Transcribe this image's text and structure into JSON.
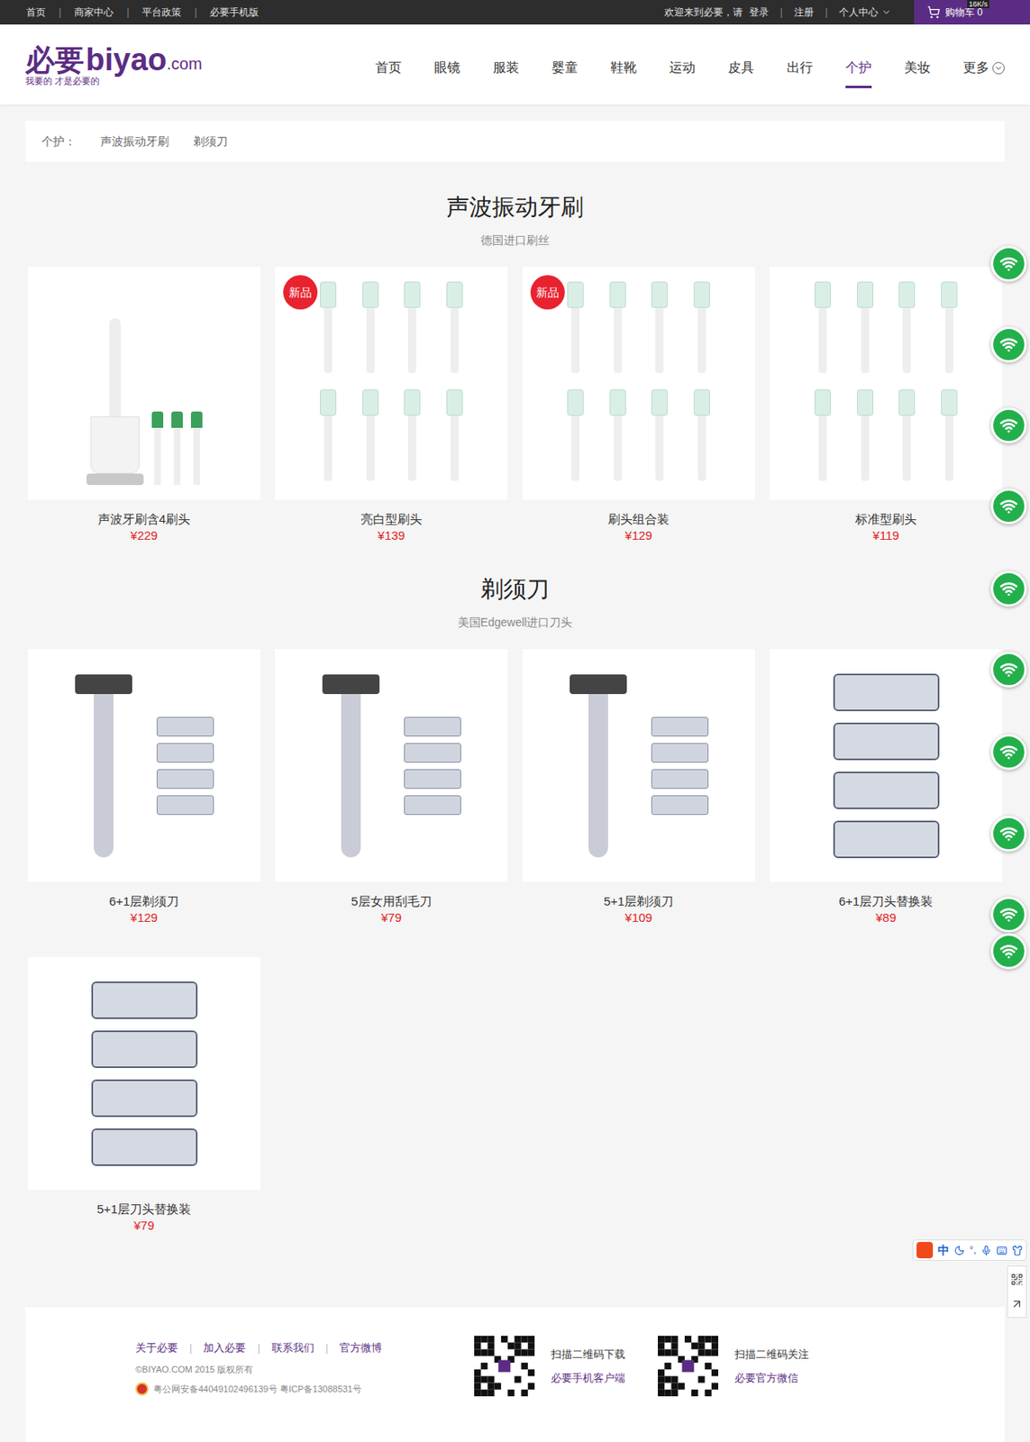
{
  "top_bar": {
    "left_links": [
      "首页",
      "商家中心",
      "平台政策",
      "必要手机版"
    ],
    "welcome": "欢迎来到必要，请",
    "login": "登录",
    "register": "注册",
    "account": "个人中心",
    "cart": "购物车 0",
    "net_speed": "16K/s"
  },
  "logo": {
    "cn": "必要",
    "en": "biyao",
    "domain": ".com",
    "tagline": "我要的 才是必要的"
  },
  "nav": [
    {
      "label": "首页",
      "selected": false
    },
    {
      "label": "眼镜",
      "selected": false
    },
    {
      "label": "服装",
      "selected": false
    },
    {
      "label": "婴童",
      "selected": false
    },
    {
      "label": "鞋靴",
      "selected": false
    },
    {
      "label": "运动",
      "selected": false
    },
    {
      "label": "皮具",
      "selected": false
    },
    {
      "label": "出行",
      "selected": false
    },
    {
      "label": "个护",
      "selected": true
    },
    {
      "label": "美妆",
      "selected": false
    },
    {
      "label": "更多",
      "selected": false
    }
  ],
  "breadcrumb": {
    "label": "个护：",
    "items": [
      "声波振动牙刷",
      "剃须刀"
    ]
  },
  "sections": [
    {
      "title": "声波振动牙刷",
      "subtitle": "德国进口刷丝",
      "products": [
        {
          "name": "声波牙刷含4刷头",
          "price": "¥229",
          "badge": "",
          "kind": "toothbrush"
        },
        {
          "name": "亮白型刷头",
          "price": "¥139",
          "badge": "新品",
          "kind": "heads"
        },
        {
          "name": "刷头组合装",
          "price": "¥129",
          "badge": "新品",
          "kind": "heads"
        },
        {
          "name": "标准型刷头",
          "price": "¥119",
          "badge": "",
          "kind": "heads"
        }
      ]
    },
    {
      "title": "剃须刀",
      "subtitle": "美国Edgewell进口刀头",
      "products": [
        {
          "name": "6+1层剃须刀",
          "price": "¥129",
          "badge": "",
          "kind": "razor"
        },
        {
          "name": "5层女用刮毛刀",
          "price": "¥79",
          "badge": "",
          "kind": "razor"
        },
        {
          "name": "5+1层剃须刀",
          "price": "¥109",
          "badge": "",
          "kind": "razor"
        },
        {
          "name": "6+1层刀头替换装",
          "price": "¥89",
          "badge": "",
          "kind": "cartridges"
        },
        {
          "name": "5+1层刀头替换装",
          "price": "¥79",
          "badge": "",
          "kind": "cartridges"
        }
      ]
    }
  ],
  "footer": {
    "links": [
      "关于必要",
      "加入必要",
      "联系我们",
      "官方微博"
    ],
    "copyright": "©BIYAO.COM 2015 版权所有",
    "icp": "粤公网安备44049102496139号 粤ICP备13088531号",
    "qr": [
      {
        "line1": "扫描二维码下载",
        "line2": "必要手机客户端"
      },
      {
        "line1": "扫描二维码关注",
        "line2": "必要官方微信"
      }
    ]
  },
  "ime": {
    "mode": "中",
    "punct": "°,"
  }
}
